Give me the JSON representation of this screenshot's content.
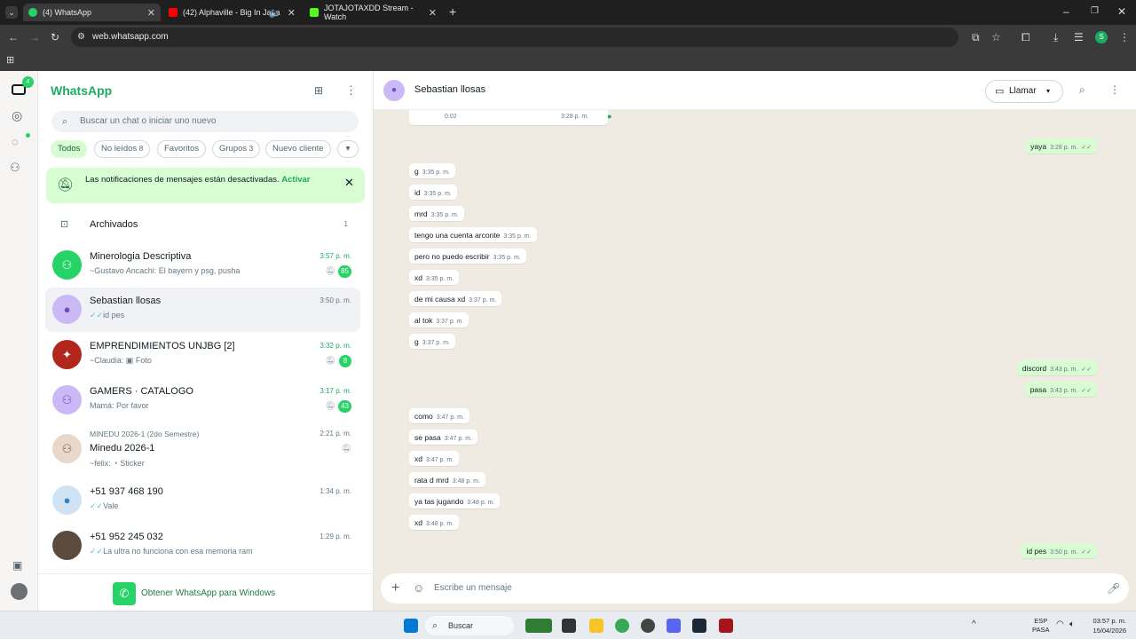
{
  "browser": {
    "tabs": [
      {
        "title": "(4) WhatsApp",
        "active": true
      },
      {
        "title": "(42) Alphaville - Big In Japa",
        "active": false
      },
      {
        "title": "JOTAJOTAXDD Stream - Watch",
        "active": false
      }
    ],
    "url": "web.whatsapp.com"
  },
  "rail": {
    "chats_badge": "4"
  },
  "sidebar": {
    "brand": "WhatsApp",
    "search_placeholder": "Buscar un chat o iniciar uno nuevo",
    "filters": [
      {
        "label": "Todos",
        "count": ""
      },
      {
        "label": "No leídos",
        "count": "8"
      },
      {
        "label": "Favoritos",
        "count": ""
      },
      {
        "label": "Grupos",
        "count": "3"
      },
      {
        "label": "Nuevo cliente",
        "count": ""
      }
    ],
    "banner": {
      "text": "Las notificaciones de mensajes están desactivadas.",
      "action": "Activar"
    },
    "archived": {
      "label": "Archivados",
      "count": "1"
    },
    "chats": [
      {
        "name": "Minerologia Descriptiva",
        "preview": "~Gustavo Ancachi: El bayern y psg, pusha",
        "time": "3:57 p. m.",
        "unread": "85"
      },
      {
        "name": "Sebastian llosas",
        "preview": "id pes",
        "time": "3:50 p. m.",
        "unread": ""
      },
      {
        "name": "EMPRENDIMIENTOS UNJBG [2]",
        "preview": "~Claudia:",
        "preview_media": "Foto",
        "time": "3:32 p. m.",
        "unread": "8"
      },
      {
        "name": "GAMERS · CATALOGO",
        "preview": "Mamá: Por favor",
        "time": "3:17 p. m.",
        "unread": "43"
      },
      {
        "community": "MINEDU 2026-1 (2do Semestre)",
        "name": "Minedu 2026-1",
        "preview": "~felix:",
        "preview_media": "Sticker",
        "time": "2:21 p. m.",
        "unread": ""
      },
      {
        "name": "+51 937 468 190",
        "preview": "Vale",
        "time": "1:34 p. m.",
        "unread": ""
      },
      {
        "name": "+51 952 245 032",
        "preview": "La ultra no funciona con esa memoria ram",
        "time": "1:29 p. m.",
        "unread": ""
      }
    ],
    "get_app": "Obtener WhatsApp para Windows"
  },
  "conversation": {
    "contact": "Sebastian llosas",
    "call_label": "Llamar",
    "audio": {
      "duration": "0:02",
      "time": "3:28 p. m."
    },
    "messages": [
      {
        "dir": "out",
        "text": "yaya",
        "time": "3:28 p. m."
      },
      {
        "dir": "in",
        "text": "g",
        "time": "3:35 p. m."
      },
      {
        "dir": "in",
        "text": "id",
        "time": "3:35 p. m."
      },
      {
        "dir": "in",
        "text": "mrd",
        "time": "3:35 p. m."
      },
      {
        "dir": "in",
        "text": "tengo una cuenta arconte",
        "time": "3:35 p. m."
      },
      {
        "dir": "in",
        "text": "pero no puedo escribir",
        "time": "3:35 p. m."
      },
      {
        "dir": "in",
        "text": "xd",
        "time": "3:35 p. m."
      },
      {
        "dir": "in",
        "text": "de mi causa xd",
        "time": "3:37 p. m."
      },
      {
        "dir": "in",
        "text": "al tok",
        "time": "3:37 p. m."
      },
      {
        "dir": "in",
        "text": "g",
        "time": "3:37 p. m."
      },
      {
        "dir": "out",
        "text": "discord",
        "time": "3:43 p. m."
      },
      {
        "dir": "out",
        "text": "pasa",
        "time": "3:43 p. m."
      },
      {
        "dir": "in",
        "text": "como",
        "time": "3:47 p. m."
      },
      {
        "dir": "in",
        "text": "se pasa",
        "time": "3:47 p. m."
      },
      {
        "dir": "in",
        "text": "xd",
        "time": "3:47 p. m."
      },
      {
        "dir": "in",
        "text": "rata d mrd",
        "time": "3:48 p. m."
      },
      {
        "dir": "in",
        "text": "ya tas jugando",
        "time": "3:48 p. m."
      },
      {
        "dir": "in",
        "text": "xd",
        "time": "3:48 p. m."
      },
      {
        "dir": "out",
        "text": "id pes",
        "time": "3:50 p. m."
      }
    ],
    "composer_placeholder": "Escribe un mensaje"
  },
  "taskbar": {
    "search_label": "Buscar",
    "lang": "ESP",
    "lang_sub": "PASA",
    "time": "03:57 p. m.",
    "date": "15/04/2026"
  },
  "colors": {
    "accent": "#25d366",
    "brand": "#1daa61",
    "outgoing": "#d9fdd3",
    "chat_bg": "#efeae2"
  }
}
